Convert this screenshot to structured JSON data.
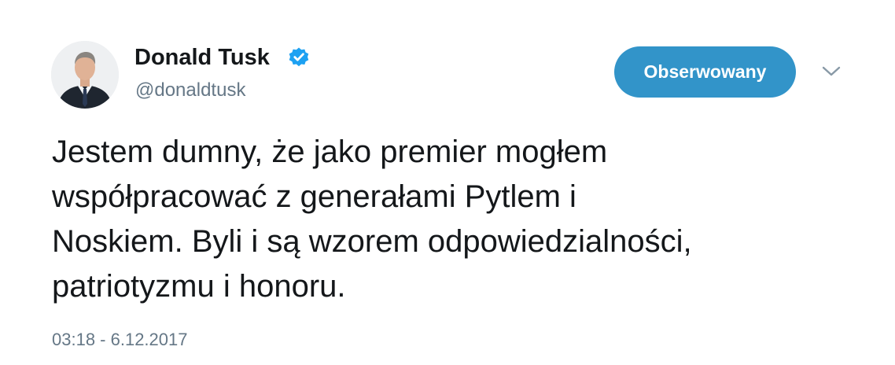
{
  "author": {
    "display_name": "Donald Tusk",
    "handle": "@donaldtusk",
    "verified": true,
    "avatar_icon": "person-portrait-icon"
  },
  "follow_button": {
    "label": "Obserwowany",
    "color": "#3294c9"
  },
  "menu": {
    "icon": "chevron-down-icon"
  },
  "tweet": {
    "lines": [
      "Jestem dumny, że jako premier mogłem",
      "współpracować z generałami Pytlem i",
      "Noskiem. Byli i są wzorem odpowiedzialności,",
      "patriotyzmu i honoru."
    ],
    "timestamp": "03:18 - 6.12.2017"
  },
  "colors": {
    "text": "#14171a",
    "secondary": "#657786",
    "verified_badge": "#1da1f2"
  }
}
